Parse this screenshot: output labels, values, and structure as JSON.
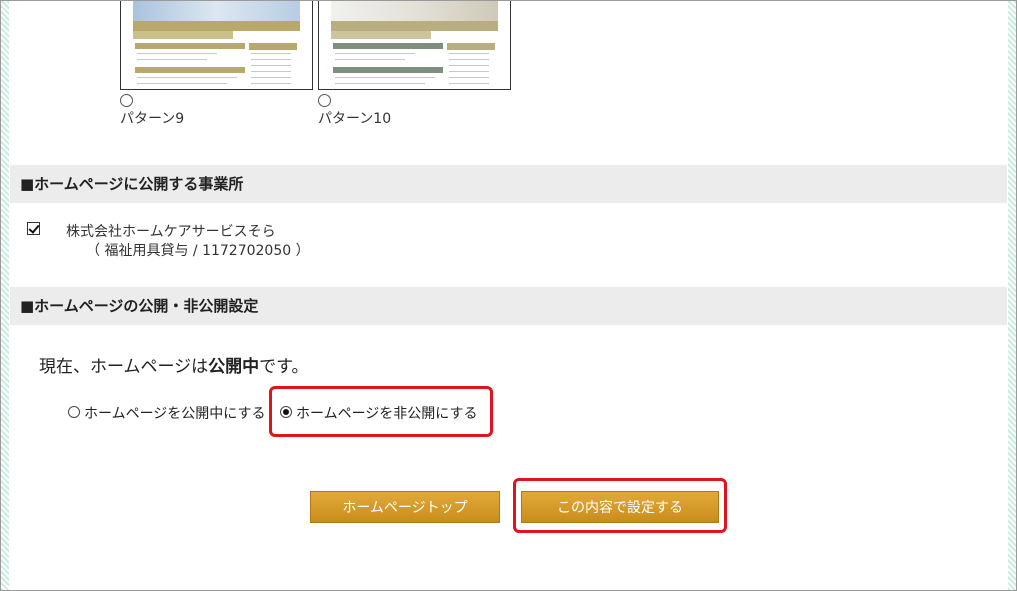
{
  "patterns": [
    {
      "label": "パターン9",
      "palette": {
        "banner": "#c9d7e6",
        "nav": "#b8a86a",
        "box": "#b8a86a",
        "side": "#b8a86a"
      }
    },
    {
      "label": "パターン10",
      "palette": {
        "banner": "#e6e6e3",
        "nav": "#b9ae80",
        "box": "#7e8f7f",
        "side": "#b9ae80"
      }
    }
  ],
  "sections": {
    "offices": {
      "title": "■ホームページに公開する事業所",
      "office_name": "株式会社ホームケアサービスそら",
      "office_detail": "（ 福祉用具貸与 / 1172702050 ）",
      "checked": true
    },
    "publish": {
      "title": "■ホームページの公開・非公開設定",
      "status_prefix": "現在、ホームページは",
      "status_value": "公開中",
      "status_suffix": "です。",
      "option_public": "ホームページを公開中にする",
      "option_private": "ホームページを非公開にする",
      "selected": "private"
    }
  },
  "buttons": {
    "top": "ホームページトップ",
    "save": "この内容で設定する"
  },
  "colors": {
    "accent_button": "#d49b2a",
    "highlight": "#e0141e",
    "section_bg": "#ececec"
  }
}
